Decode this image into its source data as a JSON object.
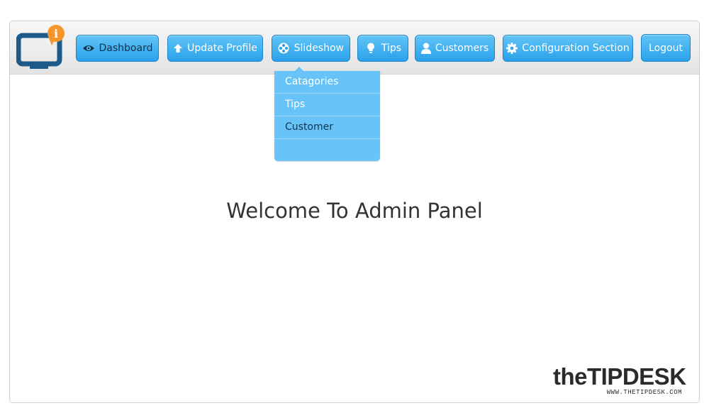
{
  "nav": {
    "dashboard": "Dashboard",
    "update_profile": "Update Profile",
    "slideshow": "Slideshow",
    "tips": "Tips",
    "customers": "Customers",
    "configuration": "Configuration Section",
    "logout": "Logout"
  },
  "dropdown": {
    "items": [
      "Catagories",
      "Tips",
      "Customer",
      ""
    ]
  },
  "main": {
    "welcome": "Welcome To Admin Panel"
  },
  "brand": {
    "name_prefix": "the",
    "name_main": "TIPDESK",
    "url": "WWW.THETIPDESK.COM"
  },
  "colors": {
    "button_top": "#62c4f7",
    "button_bottom": "#2aa1ea",
    "dropdown_bg": "#67c3f8",
    "logo_monitor": "#1d5a8a",
    "logo_bubble": "#f6962a"
  },
  "icons": {
    "logo": "monitor-info-logo-icon",
    "dashboard": "eye-icon",
    "update_profile": "upload-arrow-icon",
    "slideshow": "film-reel-icon",
    "tips": "lightbulb-icon",
    "customers": "user-icon",
    "configuration": "gear-icon"
  }
}
